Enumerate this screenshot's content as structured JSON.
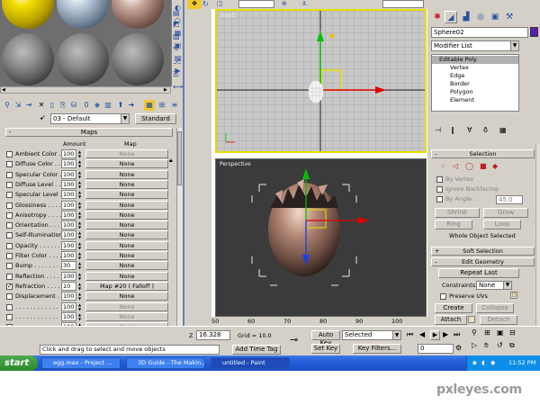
{
  "material_editor": {
    "material_name": "03 - Default",
    "type_button": "Standard",
    "maps_rollout_title": "Maps",
    "col_amount": "Amount",
    "col_map": "Map",
    "maps": [
      {
        "label": "Ambient Color . . .",
        "amount": "100",
        "map": "None",
        "checked": false,
        "grey": true
      },
      {
        "label": "Diffuse Color . . .",
        "amount": "100",
        "map": "None",
        "checked": false,
        "grey": false
      },
      {
        "label": "Specular Color . .",
        "amount": "100",
        "map": "None",
        "checked": false,
        "grey": false
      },
      {
        "label": "Diffuse Level . . .",
        "amount": "100",
        "map": "None",
        "checked": false,
        "grey": false
      },
      {
        "label": "Specular Level . .",
        "amount": "100",
        "map": "None",
        "checked": false,
        "grey": false
      },
      {
        "label": "Glossiness . . . . .",
        "amount": "100",
        "map": "None",
        "checked": false,
        "grey": false
      },
      {
        "label": "Anisotropy . . . . .",
        "amount": "100",
        "map": "None",
        "checked": false,
        "grey": false
      },
      {
        "label": "Orientation . . . . .",
        "amount": "100",
        "map": "None",
        "checked": false,
        "grey": false
      },
      {
        "label": "Self-Illumination .",
        "amount": "100",
        "map": "None",
        "checked": false,
        "grey": false
      },
      {
        "label": "Opacity . . . . . . .",
        "amount": "100",
        "map": "None",
        "checked": false,
        "grey": false
      },
      {
        "label": "Filter Color . . . .",
        "amount": "100",
        "map": "None",
        "checked": false,
        "grey": false
      },
      {
        "label": "Bump . . . . . . . .",
        "amount": "30",
        "map": "None",
        "checked": false,
        "grey": false
      },
      {
        "label": "Reflection . . . . .",
        "amount": "100",
        "map": "None",
        "checked": false,
        "grey": false
      },
      {
        "label": "Refraction . . . . .",
        "amount": "10",
        "map": "Map #20 ( Falloff )",
        "checked": true,
        "grey": false
      },
      {
        "label": "Displacement . . .",
        "amount": "100",
        "map": "None",
        "checked": false,
        "grey": false
      },
      {
        "label": ". . . . . . . . . . . .",
        "amount": "100",
        "map": "None",
        "checked": false,
        "grey": true
      },
      {
        "label": ". . . . . . . . . . . .",
        "amount": "100",
        "map": "None",
        "checked": false,
        "grey": true
      },
      {
        "label": ". . . . . . . . . . . .",
        "amount": "100",
        "map": "None",
        "checked": false,
        "grey": true
      },
      {
        "label": ". . . . . . . . . . . .",
        "amount": "100",
        "map": "None",
        "checked": false,
        "grey": true
      }
    ]
  },
  "viewports": {
    "front_label": "Front",
    "persp_label": "Perspective"
  },
  "command_panel": {
    "object_name": "Sphere02",
    "modifier_list": "Modifier List",
    "stack": [
      {
        "label": "Editable Poly",
        "indent": 8,
        "sel": true
      },
      {
        "label": "Vertex",
        "indent": 20,
        "sel": false
      },
      {
        "label": "Edge",
        "indent": 20,
        "sel": false
      },
      {
        "label": "Border",
        "indent": 20,
        "sel": false
      },
      {
        "label": "Polygon",
        "indent": 20,
        "sel": false
      },
      {
        "label": "Element",
        "indent": 20,
        "sel": false
      }
    ],
    "selection_title": "Selection",
    "by_vertex": "By Vertex",
    "ignore_backfacing": "Ignore Backfacing",
    "by_angle": "By Angle:",
    "angle_value": "45.0",
    "shrink": "Shrink",
    "grow": "Grow",
    "ring": "Ring",
    "loop": "Loop",
    "whole_object": "Whole Object Selected",
    "soft_selection": "Soft Selection",
    "edit_geometry": "Edit Geometry",
    "repeat_last": "Repeat Last",
    "constraints_label": "Constraints:",
    "constraints_value": "None",
    "preserve_uvs": "Preserve UVs",
    "create": "Create",
    "collapse": "Collapse",
    "attach": "Attach",
    "detach": "Detach"
  },
  "timeline": {
    "ticks": [
      "50",
      "60",
      "70",
      "80",
      "90",
      "100"
    ]
  },
  "status": {
    "prompt": "Click and drag to select and move objects",
    "z_label": "Z",
    "z_value": "16.328",
    "grid": "Grid = 10.0",
    "add_time_tag": "Add Time Tag",
    "auto_key": "Auto Key",
    "set_key": "Set Key",
    "key_mode": "Selected",
    "key_filters": "Key Filters...",
    "frame": "0"
  },
  "taskbar": {
    "start": "start",
    "tasks": [
      "egg.max - Project ...",
      "3D Guide - The Makin...",
      "untitled - Paint"
    ],
    "clock": "11:52 PM"
  },
  "watermark": "pxleyes.com",
  "colors": {
    "viewport_active_border": "#e8e000",
    "xp_taskbar": "#245edb",
    "egg": "#b58a78"
  }
}
